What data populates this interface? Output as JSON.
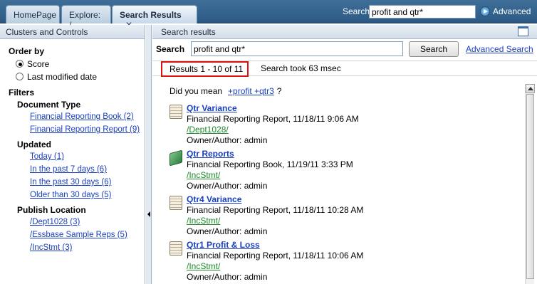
{
  "tabs": [
    {
      "label": "HomePage"
    },
    {
      "label": "Explore: /"
    },
    {
      "label": "Search Results",
      "close": "✕"
    }
  ],
  "top_search": {
    "label": "Search",
    "value": "profit and qtr*",
    "advanced_label": "Advanced"
  },
  "left_panel": {
    "header": "Clusters and Controls",
    "order_by": {
      "title": "Order by",
      "options": [
        {
          "label": "Score",
          "checked": true
        },
        {
          "label": "Last modified date",
          "checked": false
        }
      ]
    },
    "filters": {
      "title": "Filters",
      "document_type": {
        "title": "Document Type",
        "items": [
          "Financial Reporting Book (2)",
          "Financial Reporting Report (9)"
        ]
      },
      "updated": {
        "title": "Updated",
        "items": [
          "Today (1)",
          "In the past 7 days (6)",
          "In the past 30 days (6)",
          "Older than 30 days (5)"
        ]
      },
      "publish_location": {
        "title": "Publish Location",
        "items": [
          "/Dept1028 (3)",
          "/Essbase Sample Reps (5)",
          "/IncStmt (3)"
        ]
      }
    }
  },
  "right_panel": {
    "header": "Search results",
    "search": {
      "label": "Search",
      "value": "profit and qtr*",
      "button": "Search",
      "advanced_link": "Advanced Search"
    },
    "results_count": "Results  1 - 10  of  11",
    "search_time": "Search took 63 msec",
    "did_you_mean": {
      "label": "Did you mean",
      "suggestion": "+profit +qtr3",
      "trailing": "?"
    },
    "results": [
      {
        "icon": "report-icon",
        "title": "Qtr Variance",
        "meta": "Financial Reporting Report, 11/18/11 9:06 AM",
        "location": "/Dept1028/",
        "owner": "Owner/Author: admin"
      },
      {
        "icon": "book-icon",
        "title": "Qtr Reports",
        "meta": "Financial Reporting Book, 11/19/11 3:33 PM",
        "location": "/IncStmt/",
        "owner": "Owner/Author: admin"
      },
      {
        "icon": "report-icon",
        "title": "Qtr4 Variance",
        "meta": "Financial Reporting Report, 11/18/11 10:28 AM",
        "location": "/IncStmt/",
        "owner": "Owner/Author: admin"
      },
      {
        "icon": "report-icon",
        "title": "Qtr1 Profit & Loss",
        "meta": "Financial Reporting Report, 11/18/11 10:06 AM",
        "location": "/IncStmt/",
        "owner": "Owner/Author: admin"
      }
    ]
  }
}
